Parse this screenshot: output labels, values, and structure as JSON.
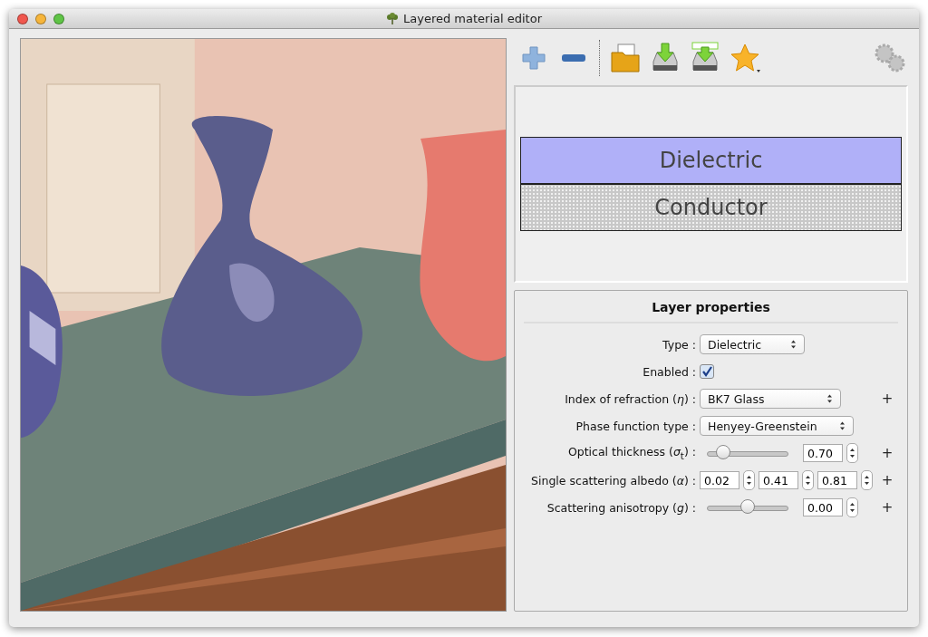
{
  "window": {
    "title": "Layered material editor"
  },
  "toolbar": [
    {
      "kind": "add"
    },
    {
      "kind": "remove"
    },
    {
      "kind": "separator"
    },
    {
      "kind": "open"
    },
    {
      "kind": "save"
    },
    {
      "kind": "save-as"
    },
    {
      "kind": "favorite"
    }
  ],
  "layers": [
    {
      "name": "Dielectric",
      "color": "#b0b0f8",
      "kind": "plain"
    },
    {
      "name": "Conductor",
      "color": "#c8c8c8",
      "kind": "dotted"
    }
  ],
  "properties": {
    "title": "Layer properties",
    "rows": [
      {
        "kind": "select",
        "label": "Type :",
        "value": "Dielectric"
      },
      {
        "kind": "checkbox",
        "label": "Enabled :",
        "checked": true
      },
      {
        "kind": "select",
        "label": "Index of refraction (*η*) :",
        "value": "BK7 Glass",
        "extra": "+"
      },
      {
        "kind": "select",
        "label": "Phase function type :",
        "value": "Henyey-Greenstein"
      },
      {
        "kind": "slider",
        "label": "Optical thickness (*σ*$_{t}$) :",
        "level": 0.2,
        "values": [
          "0.70"
        ],
        "extra": "+"
      },
      {
        "kind": "spins",
        "label": "Single scattering albedo (*α*) :",
        "values": [
          "0.02",
          "0.41",
          "0.81"
        ],
        "extra": "+"
      },
      {
        "kind": "slider",
        "label": "Scattering anisotropy (*g*) :",
        "level": 0.5,
        "values": [
          "0.00"
        ],
        "extra": "+"
      }
    ]
  }
}
